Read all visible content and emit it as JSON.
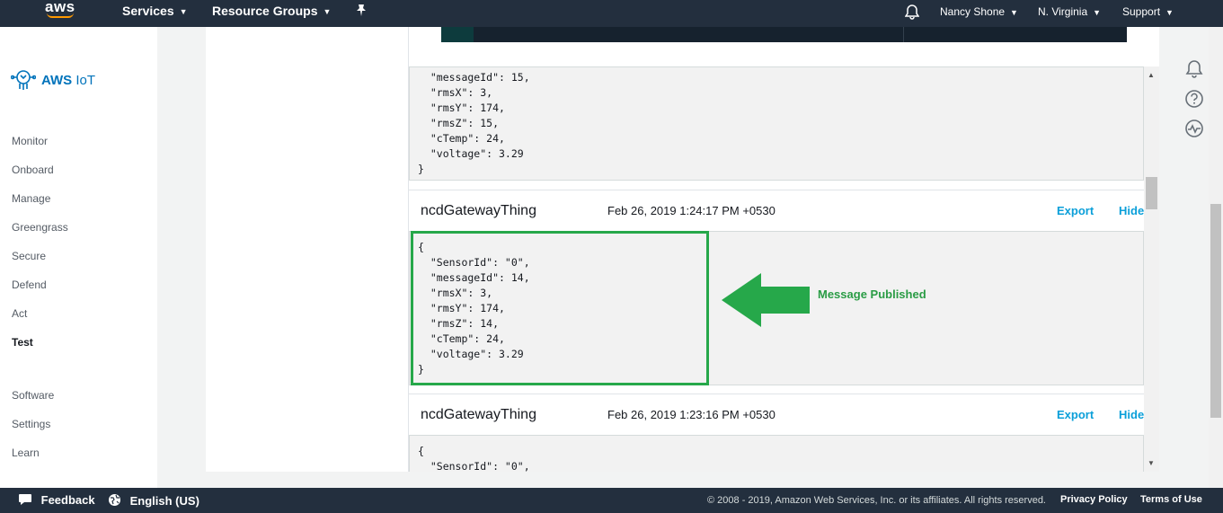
{
  "topnav": {
    "logo": "aws",
    "services": "Services",
    "resource_groups": "Resource Groups",
    "user": "Nancy Shone",
    "region": "N. Virginia",
    "support": "Support"
  },
  "sidebar": {
    "brand": "AWS",
    "brand_suffix": "IoT",
    "items": [
      "Monitor",
      "Onboard",
      "Manage",
      "Greengrass",
      "Secure",
      "Defend",
      "Act",
      "Test",
      "Software",
      "Settings",
      "Learn"
    ],
    "active": "Test"
  },
  "messages": [
    {
      "partial_code": "  \"messageId\": 15,\n  \"rmsX\": 3,\n  \"rmsY\": 174,\n  \"rmsZ\": 15,\n  \"cTemp\": 24,\n  \"voltage\": 3.29\n}"
    },
    {
      "topic": "ncdGatewayThing",
      "time": "Feb 26, 2019 1:24:17 PM +0530",
      "export": "Export",
      "hide": "Hide",
      "code": "{\n  \"SensorId\": \"0\",\n  \"messageId\": 14,\n  \"rmsX\": 3,\n  \"rmsY\": 174,\n  \"rmsZ\": 14,\n  \"cTemp\": 24,\n  \"voltage\": 3.29\n}"
    },
    {
      "topic": "ncdGatewayThing",
      "time": "Feb 26, 2019 1:23:16 PM +0530",
      "export": "Export",
      "hide": "Hide",
      "code": "{\n  \"SensorId\": \"0\","
    }
  ],
  "annotation": "Message Published",
  "colors": {
    "nav_bg": "#232f3e",
    "link_blue": "#0b9fd9",
    "highlight_green": "#26a84a",
    "annotation_green": "#2a9c45"
  },
  "footer": {
    "feedback": "Feedback",
    "language": "English (US)",
    "copyright": "© 2008 - 2019, Amazon Web Services, Inc. or its affiliates. All rights reserved.",
    "privacy": "Privacy Policy",
    "terms": "Terms of Use"
  }
}
